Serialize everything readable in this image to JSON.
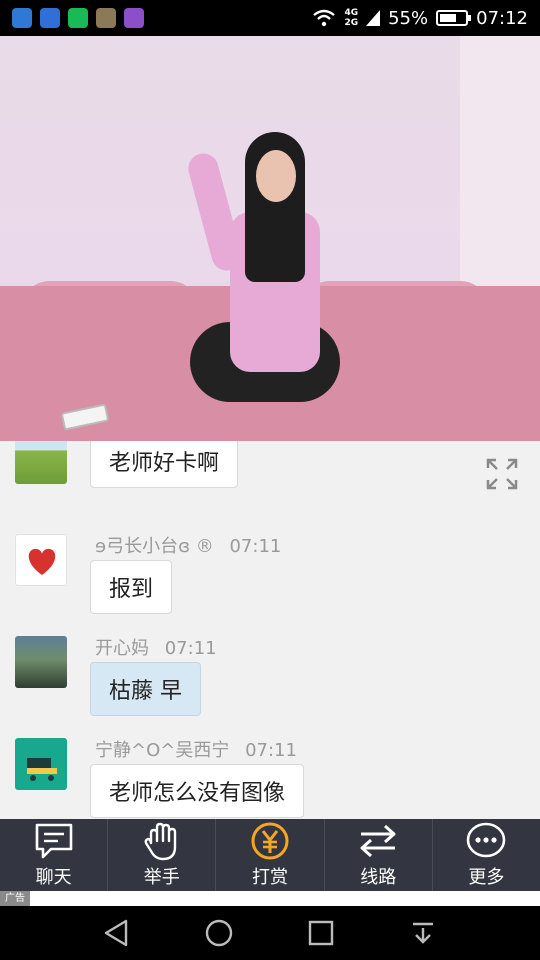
{
  "status_bar": {
    "network_top": "4G",
    "network_bottom": "2G",
    "battery_percent": "55%",
    "battery_level": 0.55,
    "time": "07:12",
    "app_icons": [
      "app-circle-icon",
      "shield-icon",
      "wallet-icon",
      "game-icon",
      "gallery-icon"
    ]
  },
  "chat": {
    "messages": [
      {
        "user": "",
        "time": "",
        "text": "老师好卡啊",
        "bubble": "white"
      },
      {
        "user": "ɘ弓长小台ɞ ®",
        "time": "07:11",
        "text": "报到",
        "bubble": "white"
      },
      {
        "user": "开心妈",
        "time": "07:11",
        "text": "枯藤 早",
        "bubble": "blue"
      },
      {
        "user": "宁静^O^吴西宁",
        "time": "07:11",
        "text": "老师怎么没有图像",
        "bubble": "white"
      }
    ]
  },
  "bottom_bar": {
    "tabs": [
      {
        "label": "聊天",
        "icon": "chat-icon"
      },
      {
        "label": "举手",
        "icon": "raise-hand-icon"
      },
      {
        "label": "打赏",
        "icon": "yuan-reward-icon"
      },
      {
        "label": "线路",
        "icon": "switch-line-icon"
      },
      {
        "label": "更多",
        "icon": "more-icon"
      }
    ]
  },
  "ad": {
    "label": "广告"
  },
  "colors": {
    "bottom_bar_bg": "#333640",
    "reward_accent": "#f5a623",
    "blue_bubble": "#d7e8f5"
  }
}
